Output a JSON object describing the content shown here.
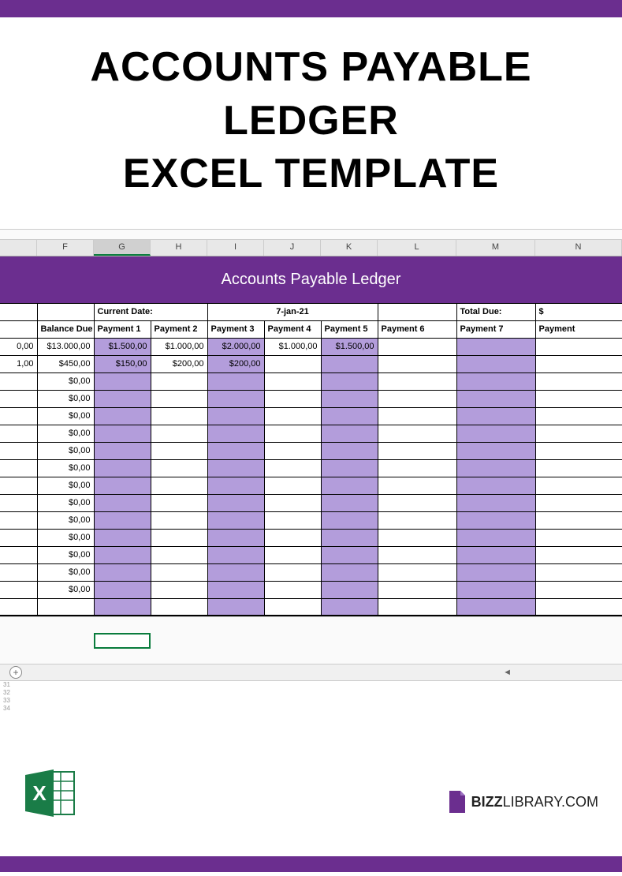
{
  "title_line1": "ACCOUNTS PAYABLE LEDGER",
  "title_line2": "EXCEL TEMPLATE",
  "column_letters": [
    "F",
    "G",
    "H",
    "I",
    "J",
    "K",
    "L",
    "M",
    "N"
  ],
  "selected_column": "G",
  "banner": "Accounts Payable Ledger",
  "info": {
    "current_date_label": "Current Date:",
    "current_date_value": "7-jan-21",
    "total_due_label": "Total Due:",
    "total_due_value": "$"
  },
  "headers": [
    "Balance Due",
    "Payment 1",
    "Payment 2",
    "Payment 3",
    "Payment 4",
    "Payment 5",
    "Payment 6",
    "Payment 7",
    "Payment"
  ],
  "row1": {
    "balance_left": "0,00",
    "balance": "$13.000,00",
    "p1": "$1.500,00",
    "p2": "$1.000,00",
    "p3": "$2.000,00",
    "p4": "$1.000,00",
    "p5": "$1.500,00",
    "p6": "",
    "p7": ""
  },
  "row2": {
    "balance_left": "1,00",
    "balance": "$450,00",
    "p1": "$150,00",
    "p2": "$200,00",
    "p3": "$200,00",
    "p4": "",
    "p5": "",
    "p6": "",
    "p7": ""
  },
  "empty_balance": "$0,00",
  "plus_label": "+",
  "brand_bold": "BIZZ",
  "brand_light": "LIBRARY.COM",
  "colors": {
    "purple": "#6b2e8f",
    "lavender": "#b39ddb",
    "green": "#1a7c47"
  }
}
